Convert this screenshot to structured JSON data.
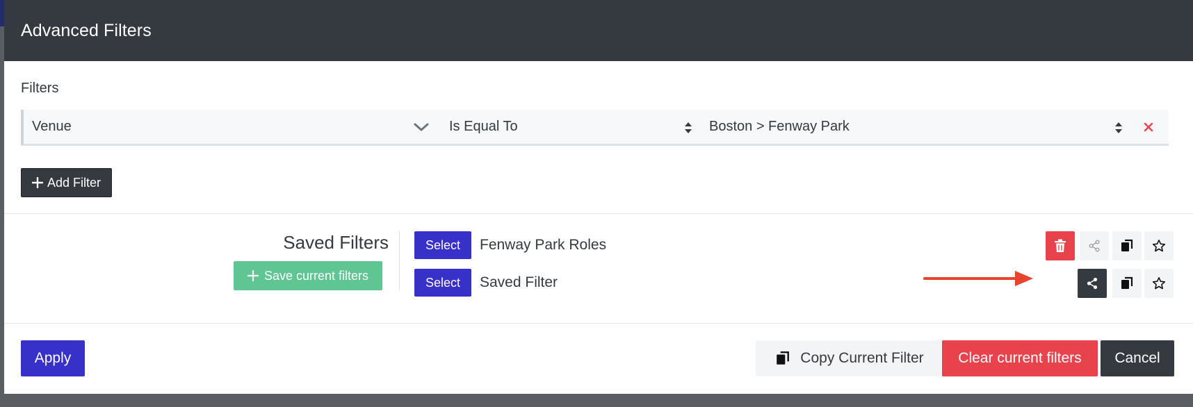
{
  "modal": {
    "title": "Advanced Filters"
  },
  "filters": {
    "label": "Filters",
    "rows": [
      {
        "field": "Venue",
        "operator": "Is Equal To",
        "value": "Boston > Fenway Park"
      }
    ],
    "add_filter_label": "Add Filter"
  },
  "saved_filters": {
    "title": "Saved Filters",
    "save_current_label": "Save current filters",
    "items": [
      {
        "select_label": "Select",
        "name": "Fenway Park Roles"
      },
      {
        "select_label": "Select",
        "name": "Saved Filter"
      }
    ]
  },
  "footer": {
    "apply_label": "Apply",
    "copy_current_label": "Copy Current Filter",
    "clear_label": "Clear current filters",
    "cancel_label": "Cancel"
  },
  "colors": {
    "header_bg": "#343a40",
    "primary": "#3730c9",
    "danger": "#e8424d",
    "success": "#5ec593",
    "annotation_arrow": "#e8432d"
  },
  "icons": [
    "chevron-down-icon",
    "sort-updown-icon",
    "close-icon",
    "plus-icon",
    "trash-icon",
    "share-icon",
    "copy-icon",
    "star-icon",
    "arrow-right-icon"
  ]
}
